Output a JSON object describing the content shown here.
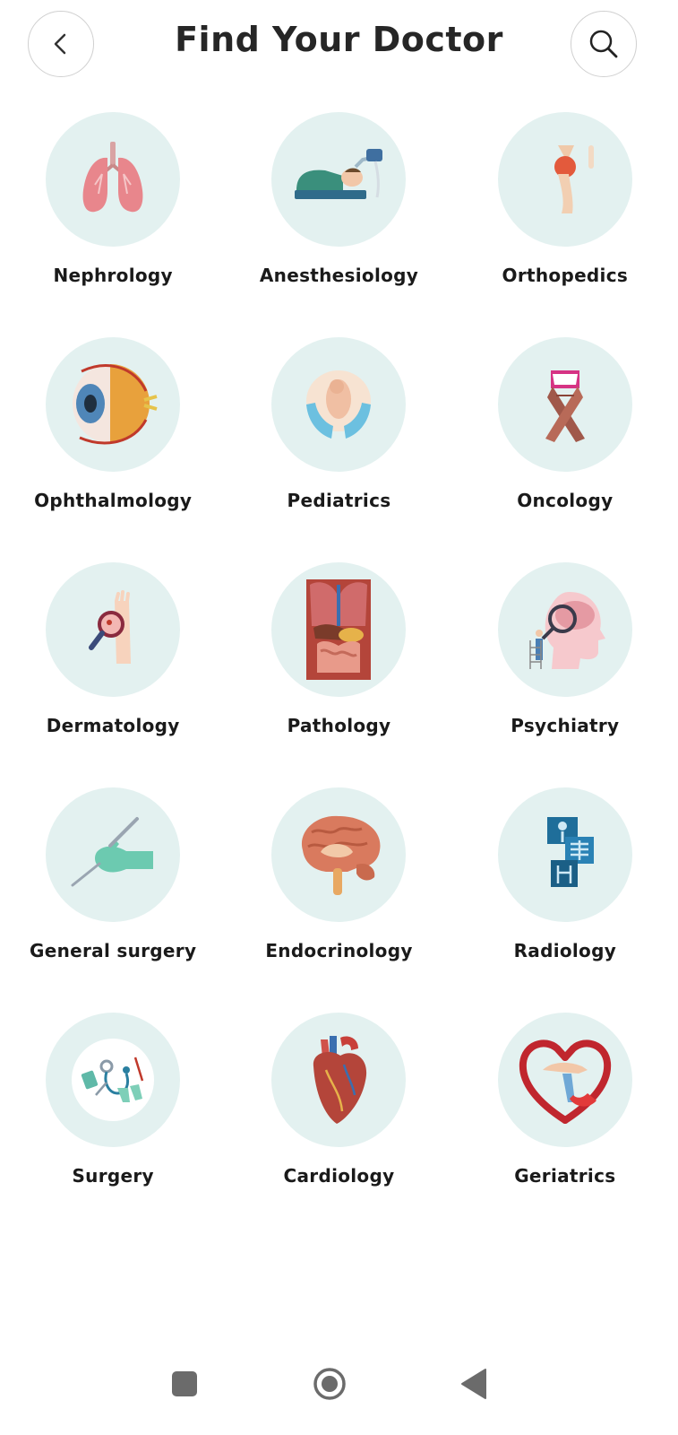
{
  "header": {
    "title": "Find Your Doctor",
    "back_icon": "chevron-left-icon",
    "search_icon": "search-icon"
  },
  "specialties": [
    {
      "label": "Nephrology",
      "icon": "lungs-icon"
    },
    {
      "label": "Anesthesiology",
      "icon": "anesthesia-mask-icon"
    },
    {
      "label": "Orthopedics",
      "icon": "knee-joint-icon"
    },
    {
      "label": "Ophthalmology",
      "icon": "eyeball-anatomy-icon"
    },
    {
      "label": "Pediatrics",
      "icon": "baby-in-hands-icon"
    },
    {
      "label": "Oncology",
      "icon": "awareness-ribbon-icon"
    },
    {
      "label": "Dermatology",
      "icon": "skin-magnifier-icon"
    },
    {
      "label": "Pathology",
      "icon": "torso-organs-icon"
    },
    {
      "label": "Psychiatry",
      "icon": "head-brain-magnifier-icon"
    },
    {
      "label": "General surgery",
      "icon": "hand-scalpel-icon"
    },
    {
      "label": "Endocrinology",
      "icon": "brain-icon"
    },
    {
      "label": "Radiology",
      "icon": "xray-skeleton-icon"
    },
    {
      "label": "Surgery",
      "icon": "surgical-tools-icon"
    },
    {
      "label": "Cardiology",
      "icon": "heart-anatomy-icon"
    },
    {
      "label": "Geriatrics",
      "icon": "heart-hands-icon"
    }
  ],
  "navbar": {
    "recents_icon": "recents-square-icon",
    "home_icon": "home-circle-icon",
    "back_icon": "back-triangle-icon"
  },
  "colors": {
    "tile_background": "#e3f1f0",
    "title_text": "#262626",
    "nav_icon": "#6b6b6b"
  }
}
